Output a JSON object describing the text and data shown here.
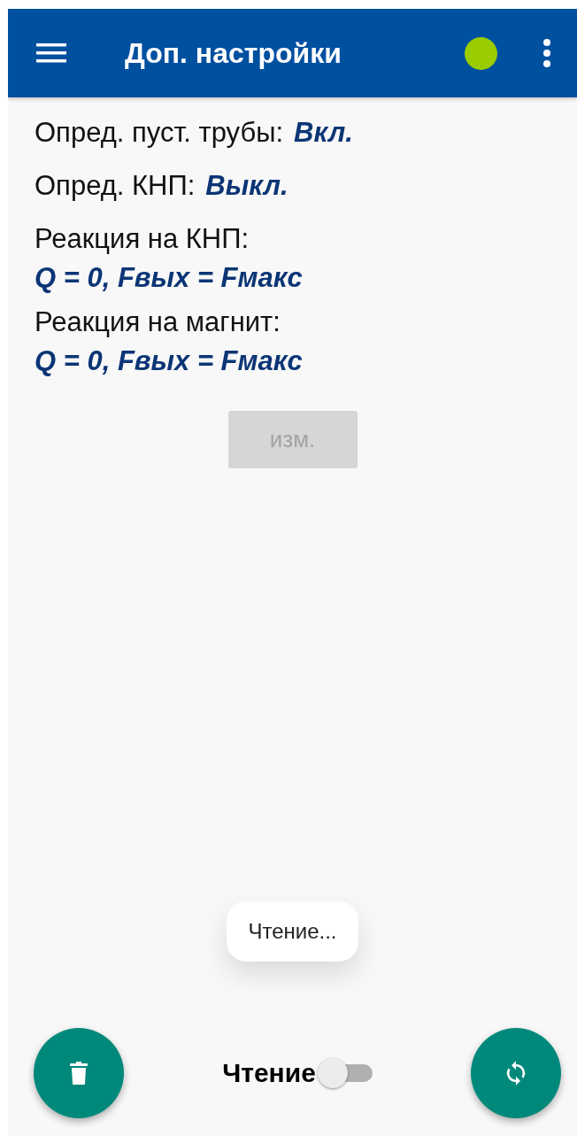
{
  "app_bar": {
    "title": "Доп. настройки"
  },
  "settings": [
    {
      "kind": "inline",
      "label": "Опред. пуст. трубы:",
      "value": "Вкл."
    },
    {
      "kind": "inline",
      "label": "Опред. КНП:",
      "value": "Выкл."
    },
    {
      "kind": "stacked",
      "label": "Реакция на КНП:",
      "value": "Q = 0, Fвых = Fмакс"
    },
    {
      "kind": "stacked",
      "label": "Реакция на магнит:",
      "value": "Q = 0, Fвых = Fмакс"
    }
  ],
  "edit_button": {
    "label": "изм.",
    "disabled": true
  },
  "toast": "Чтение...",
  "read_toggle": {
    "label": "Чтение",
    "on": false
  }
}
